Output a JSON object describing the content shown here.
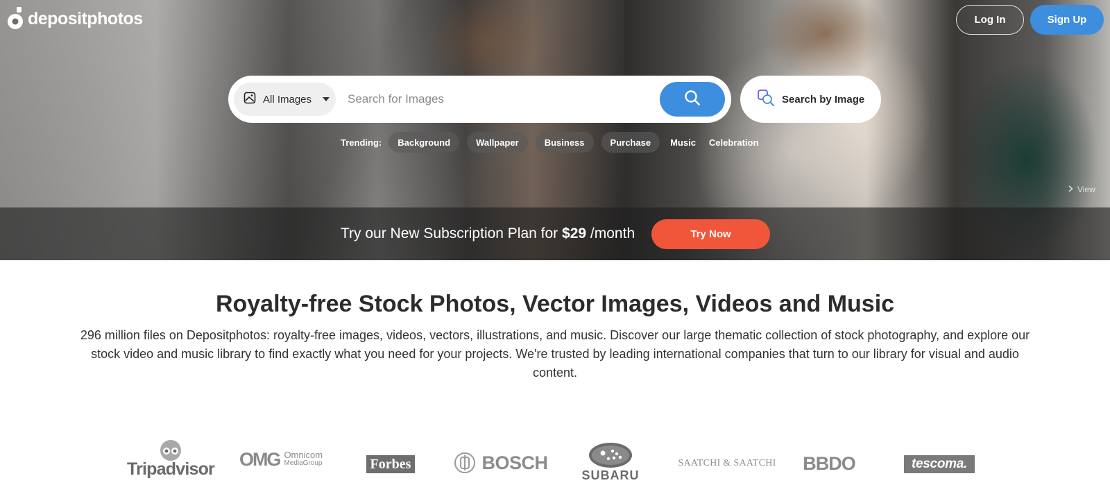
{
  "brand": {
    "name": "depositphotos"
  },
  "header": {
    "login_label": "Log In",
    "signup_label": "Sign Up"
  },
  "search": {
    "type_label": "All Images",
    "placeholder": "Search for Images",
    "by_image_label": "Search by Image"
  },
  "trending": {
    "label": "Trending:",
    "items": [
      "Background",
      "Wallpaper",
      "Business",
      "Purchase",
      "Music",
      "Celebration"
    ]
  },
  "hero": {
    "view_label": "View"
  },
  "promo": {
    "text_before": "Try our New Subscription Plan for",
    "price": "$29",
    "text_after": "/month",
    "cta_label": "Try Now"
  },
  "main": {
    "title": "Royalty-free Stock Photos, Vector Images, Videos and Music",
    "description": "296 million files on Depositphotos: royalty-free images, videos, vectors, illustrations, and music. Discover our large thematic collection of stock photography, and explore our stock video and music library to find exactly what you need for your projects. We're trusted by leading international companies that turn to our library for visual and audio content."
  },
  "clients": {
    "tripadvisor": "Tripadvisor",
    "omg": "OMG",
    "omg_sub1": "Omnicom",
    "omg_sub2": "MediaGroup",
    "forbes": "Forbes",
    "bosch": "BOSCH",
    "subaru": "SUBARU",
    "saatchi": "SAATCHI & SAATCHI",
    "bbdo": "BBDO",
    "tescoma": "tescoma."
  },
  "colors": {
    "accent": "#3e8ee0",
    "cta": "#f1563a",
    "text": "#2c2c2c",
    "logo_gray": "#7c7c7c"
  },
  "icons": [
    "logo-mark-icon",
    "image-type-icon",
    "caret-down-icon",
    "search-icon",
    "search-by-image-icon",
    "chevron-right-icon"
  ]
}
